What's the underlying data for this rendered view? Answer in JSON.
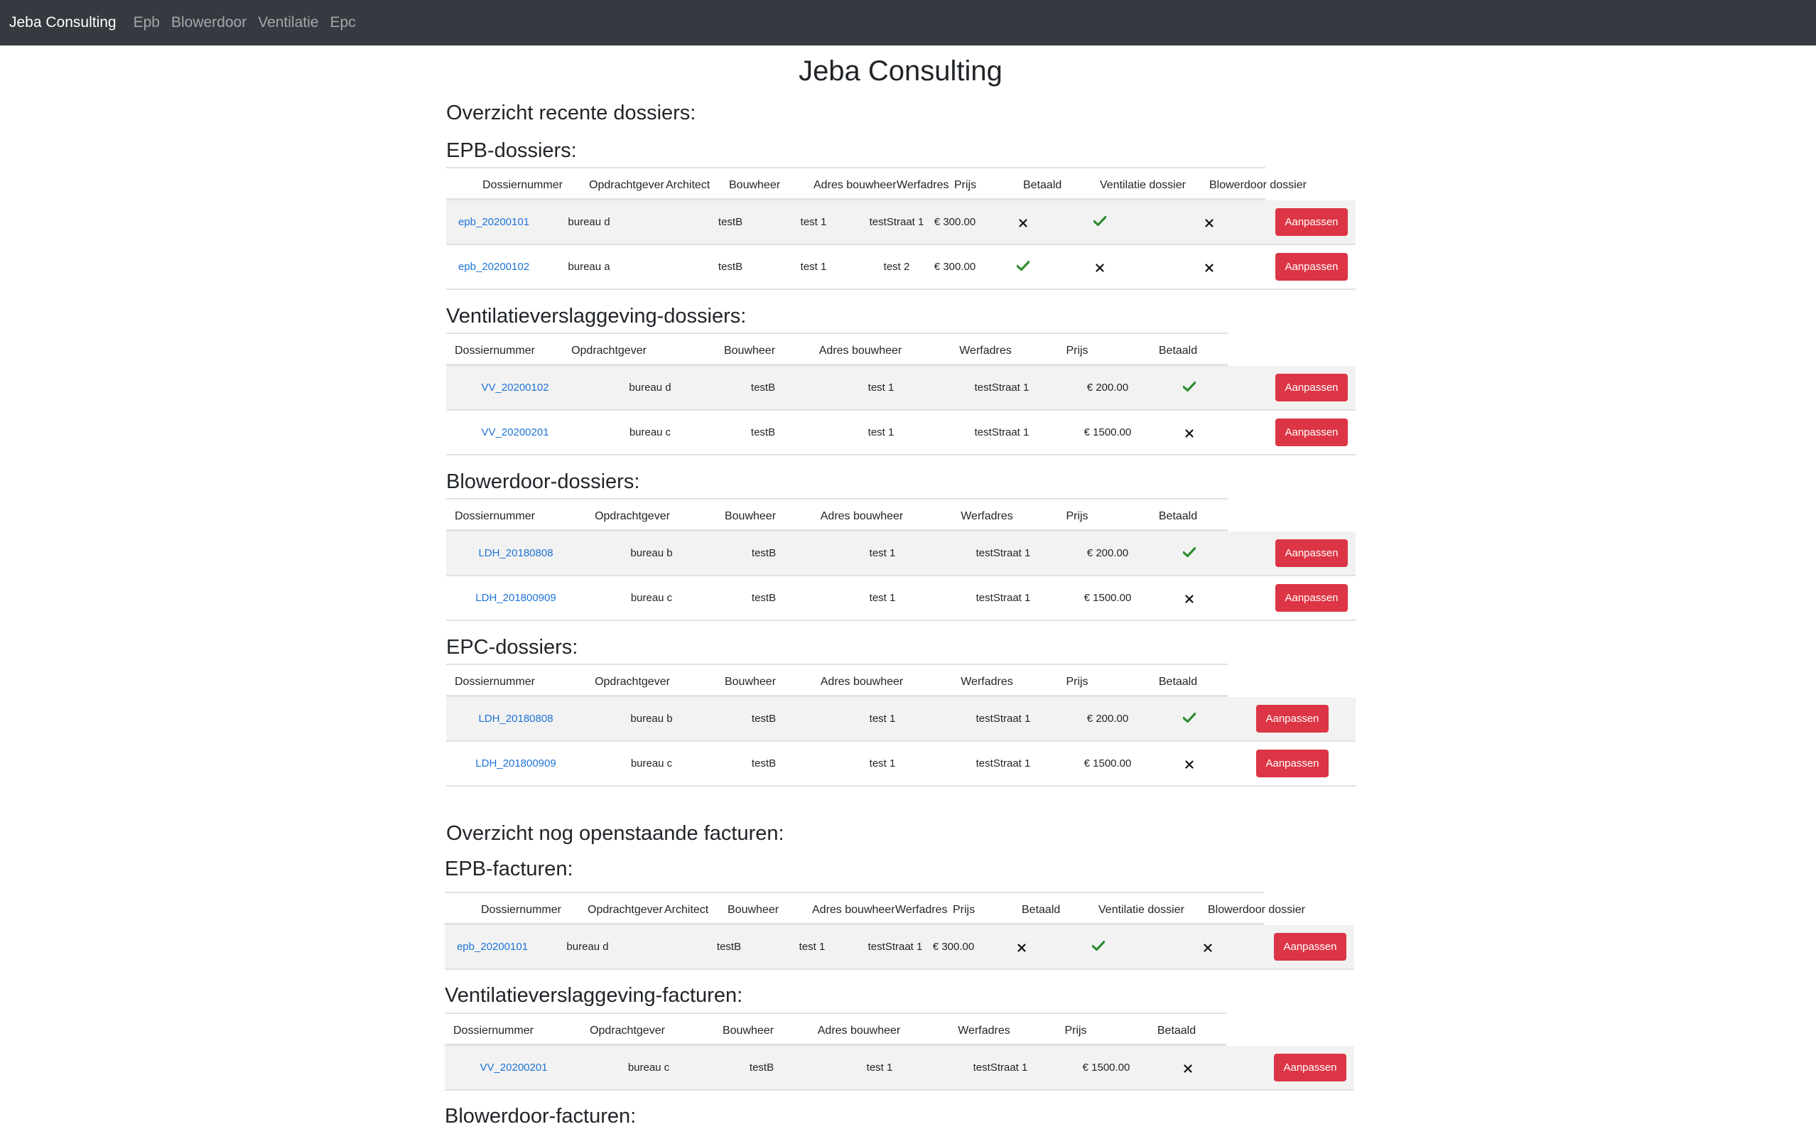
{
  "navbar": {
    "brand": "Jeba Consulting",
    "links": [
      "Epb",
      "Blowerdoor",
      "Ventilatie",
      "Epc"
    ]
  },
  "page": {
    "title": "Jeba Consulting",
    "recent_heading": "Overzicht recente dossiers:",
    "open_heading": "Overzicht nog openstaande facturen:"
  },
  "action_label": "Aanpassen",
  "icons": {
    "check": "check-icon",
    "cross": "cross-icon"
  },
  "colors": {
    "navbar": "#343a40",
    "link": "#1e74d6",
    "button": "#dc3545",
    "check": "#2e8b2e"
  },
  "sections": [
    {
      "title": "EPB-dossiers:",
      "columns": [
        "Dossiernummer",
        "Opdrachtgever",
        "Architect",
        "Bouwheer",
        "Adres bouwheer",
        "Werfadres",
        "Prijs",
        "Betaald",
        "Ventilatie dossier",
        "Blowerdoor dossier"
      ],
      "rows": [
        [
          "epb_20200101",
          "bureau d",
          "",
          "testB",
          "test 1",
          "testStraat 1",
          "€ 300.00",
          false,
          true,
          false
        ],
        [
          "epb_20200102",
          "bureau a",
          "",
          "testB",
          "test 1",
          "test 2",
          "€ 300.00",
          true,
          false,
          false
        ]
      ]
    },
    {
      "title": "Ventilatieverslaggeving-dossiers:",
      "columns": [
        "Dossiernummer",
        "Opdrachtgever",
        "Bouwheer",
        "Adres bouwheer",
        "Werfadres",
        "Prijs",
        "Betaald"
      ],
      "rows": [
        [
          "VV_20200102",
          "bureau d",
          "testB",
          "test 1",
          "testStraat 1",
          "€ 200.00",
          true
        ],
        [
          "VV_20200201",
          "bureau c",
          "testB",
          "test 1",
          "testStraat 1",
          "€ 1500.00",
          false
        ]
      ]
    },
    {
      "title": "Blowerdoor-dossiers:",
      "columns": [
        "Dossiernummer",
        "Opdrachtgever",
        "Bouwheer",
        "Adres bouwheer",
        "Werfadres",
        "Prijs",
        "Betaald"
      ],
      "rows": [
        [
          "LDH_20180808",
          "bureau b",
          "testB",
          "test 1",
          "testStraat 1",
          "€ 200.00",
          true
        ],
        [
          "LDH_201800909",
          "bureau c",
          "testB",
          "test 1",
          "testStraat 1",
          "€ 1500.00",
          false
        ]
      ]
    },
    {
      "title": "EPC-dossiers:",
      "columns": [
        "Dossiernummer",
        "Opdrachtgever",
        "Bouwheer",
        "Adres bouwheer",
        "Werfadres",
        "Prijs",
        "Betaald"
      ],
      "rows": [
        [
          "LDH_20180808",
          "bureau b",
          "testB",
          "test 1",
          "testStraat 1",
          "€ 200.00",
          true
        ],
        [
          "LDH_201800909",
          "bureau c",
          "testB",
          "test 1",
          "testStraat 1",
          "€ 1500.00",
          false
        ]
      ]
    },
    {
      "title": "EPB-facturen:",
      "columns": [
        "Dossiernummer",
        "Opdrachtgever",
        "Architect",
        "Bouwheer",
        "Adres bouwheer",
        "Werfadres",
        "Prijs",
        "Betaald",
        "Ventilatie dossier",
        "Blowerdoor dossier"
      ],
      "rows": [
        [
          "epb_20200101",
          "bureau d",
          "",
          "testB",
          "test 1",
          "testStraat 1",
          "€ 300.00",
          false,
          true,
          false
        ]
      ]
    },
    {
      "title": "Ventilatieverslaggeving-facturen:",
      "columns": [
        "Dossiernummer",
        "Opdrachtgever",
        "Bouwheer",
        "Adres bouwheer",
        "Werfadres",
        "Prijs",
        "Betaald"
      ],
      "rows": [
        [
          "VV_20200201",
          "bureau c",
          "testB",
          "test 1",
          "testStraat 1",
          "€ 1500.00",
          false
        ]
      ]
    },
    {
      "title": "Blowerdoor-facturen:",
      "columns": [],
      "rows": []
    }
  ]
}
